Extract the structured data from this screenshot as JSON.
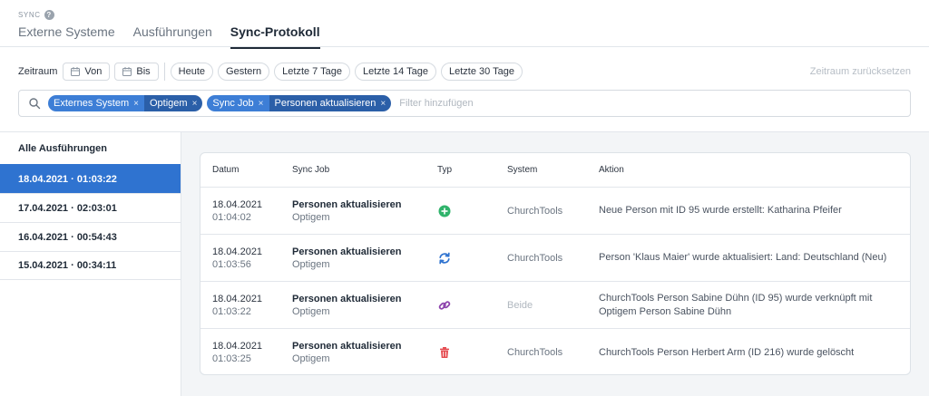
{
  "header": {
    "app_label": "SYNC",
    "tabs": [
      {
        "label": "Externe Systeme"
      },
      {
        "label": "Ausführungen"
      },
      {
        "label": "Sync-Protokoll"
      }
    ]
  },
  "filters": {
    "zeitraum_label": "Zeitraum",
    "from_label": "Von",
    "to_label": "Bis",
    "presets": [
      "Heute",
      "Gestern",
      "Letzte 7 Tage",
      "Letzte 14 Tage",
      "Letzte 30 Tage"
    ],
    "reset_label": "Zeitraum zurücksetzen"
  },
  "search": {
    "tags": [
      {
        "key": "Externes System",
        "value": "Optigem"
      },
      {
        "key": "Sync Job",
        "value": "Personen aktualisieren"
      }
    ],
    "placeholder": "Filter hinzufügen"
  },
  "sidebar": {
    "heading": "Alle Ausführungen",
    "items": [
      {
        "label": "18.04.2021 · 01:03:22"
      },
      {
        "label": "17.04.2021 · 02:03:01"
      },
      {
        "label": "16.04.2021 · 00:54:43"
      },
      {
        "label": "15.04.2021 · 00:34:11"
      }
    ]
  },
  "table": {
    "columns": [
      "Datum",
      "Sync Job",
      "Typ",
      "System",
      "Aktion"
    ],
    "rows": [
      {
        "date": "18.04.2021",
        "time": "01:04:02",
        "job": "Personen aktualisieren",
        "job_system": "Optigem",
        "type_icon": "plus-circle-icon",
        "system": "ChurchTools",
        "action": "Neue Person mit ID 95 wurde erstellt: Katharina Pfeifer"
      },
      {
        "date": "18.04.2021",
        "time": "01:03:56",
        "job": "Personen aktualisieren",
        "job_system": "Optigem",
        "type_icon": "sync-icon",
        "system": "ChurchTools",
        "action": "Person 'Klaus Maier' wurde aktualisiert: Land: Deutschland (Neu)"
      },
      {
        "date": "18.04.2021",
        "time": "01:03:22",
        "job": "Personen aktualisieren",
        "job_system": "Optigem",
        "type_icon": "link-icon",
        "system": "Beide",
        "action": "ChurchTools Person Sabine Dühn (ID 95) wurde verknüpft mit Optigem Person Sabine Dühn"
      },
      {
        "date": "18.04.2021",
        "time": "01:03:25",
        "job": "Personen aktualisieren",
        "job_system": "Optigem",
        "type_icon": "trash-icon",
        "system": "ChurchTools",
        "action": "ChurchTools Person Herbert Arm (ID 216) wurde gelöscht"
      }
    ]
  },
  "colors": {
    "accent": "#2f73d0",
    "create": "#2fb36b",
    "update": "#2f73d0",
    "link": "#8e44ad",
    "delete": "#e5484d"
  }
}
